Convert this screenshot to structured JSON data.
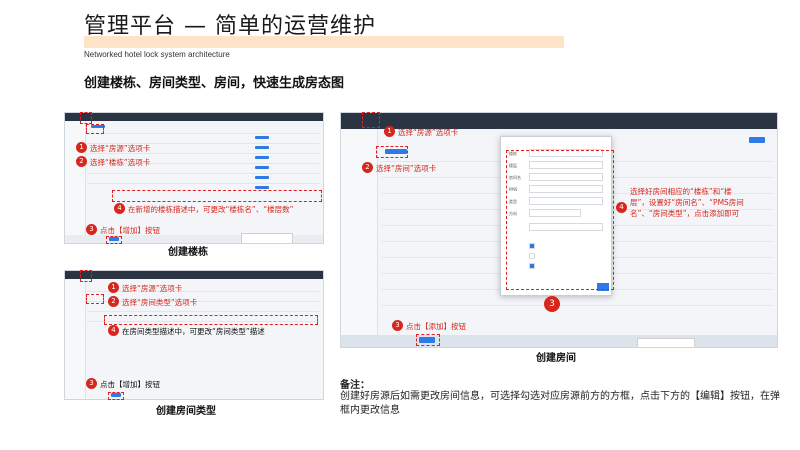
{
  "header": {
    "title": "管理平台 — 简单的运营维护",
    "subtitle": "Networked hotel lock system architecture",
    "heading": "创建楼栋、房间类型、房间，快速生成房态图"
  },
  "panel_building": {
    "caption": "创建楼栋",
    "steps": [
      {
        "num": "1",
        "text": "选择“房源”选项卡"
      },
      {
        "num": "2",
        "text": "选择“楼栋”选项卡"
      },
      {
        "num": "4",
        "text": "在新增的楼栋描述中，可更改“楼栋名”、“楼层数”"
      },
      {
        "num": "3",
        "text": "点击【增加】按钮"
      }
    ]
  },
  "panel_roomtype": {
    "caption": "创建房间类型",
    "steps": [
      {
        "num": "1",
        "text": "选择“房源”选项卡"
      },
      {
        "num": "2",
        "text": "选择“房间类型”选项卡"
      },
      {
        "num": "4",
        "text": "在房间类型描述中，可更改“房间类型”描述"
      },
      {
        "num": "3",
        "text": "点击【增加】按钮"
      }
    ]
  },
  "panel_room": {
    "caption": "创建房间",
    "steps": [
      {
        "num": "1",
        "text": "选择“房源”选项卡"
      },
      {
        "num": "2",
        "text": "选择“房间”选项卡"
      },
      {
        "num": "4",
        "text": "选择好房间相应的“楼栋”和“楼层”，设置好“房间名”、“PMS房间名”、“房间类型”，点击添加即可"
      },
      {
        "num": "3",
        "text": "点击【添加】按钮"
      },
      {
        "num": "3",
        "text": ""
      }
    ]
  },
  "note": {
    "label": "备注：",
    "text": "创建好房源后如需更改房间信息，可选择勾选对应房源前方的方框，点击下方的【编辑】按钮，在弹框内更改信息"
  },
  "colors": {
    "annotation_red": "#d9261c",
    "title_highlight": "#fde3c8",
    "app_topbar": "#2b3442",
    "app_button": "#2f7be5"
  }
}
